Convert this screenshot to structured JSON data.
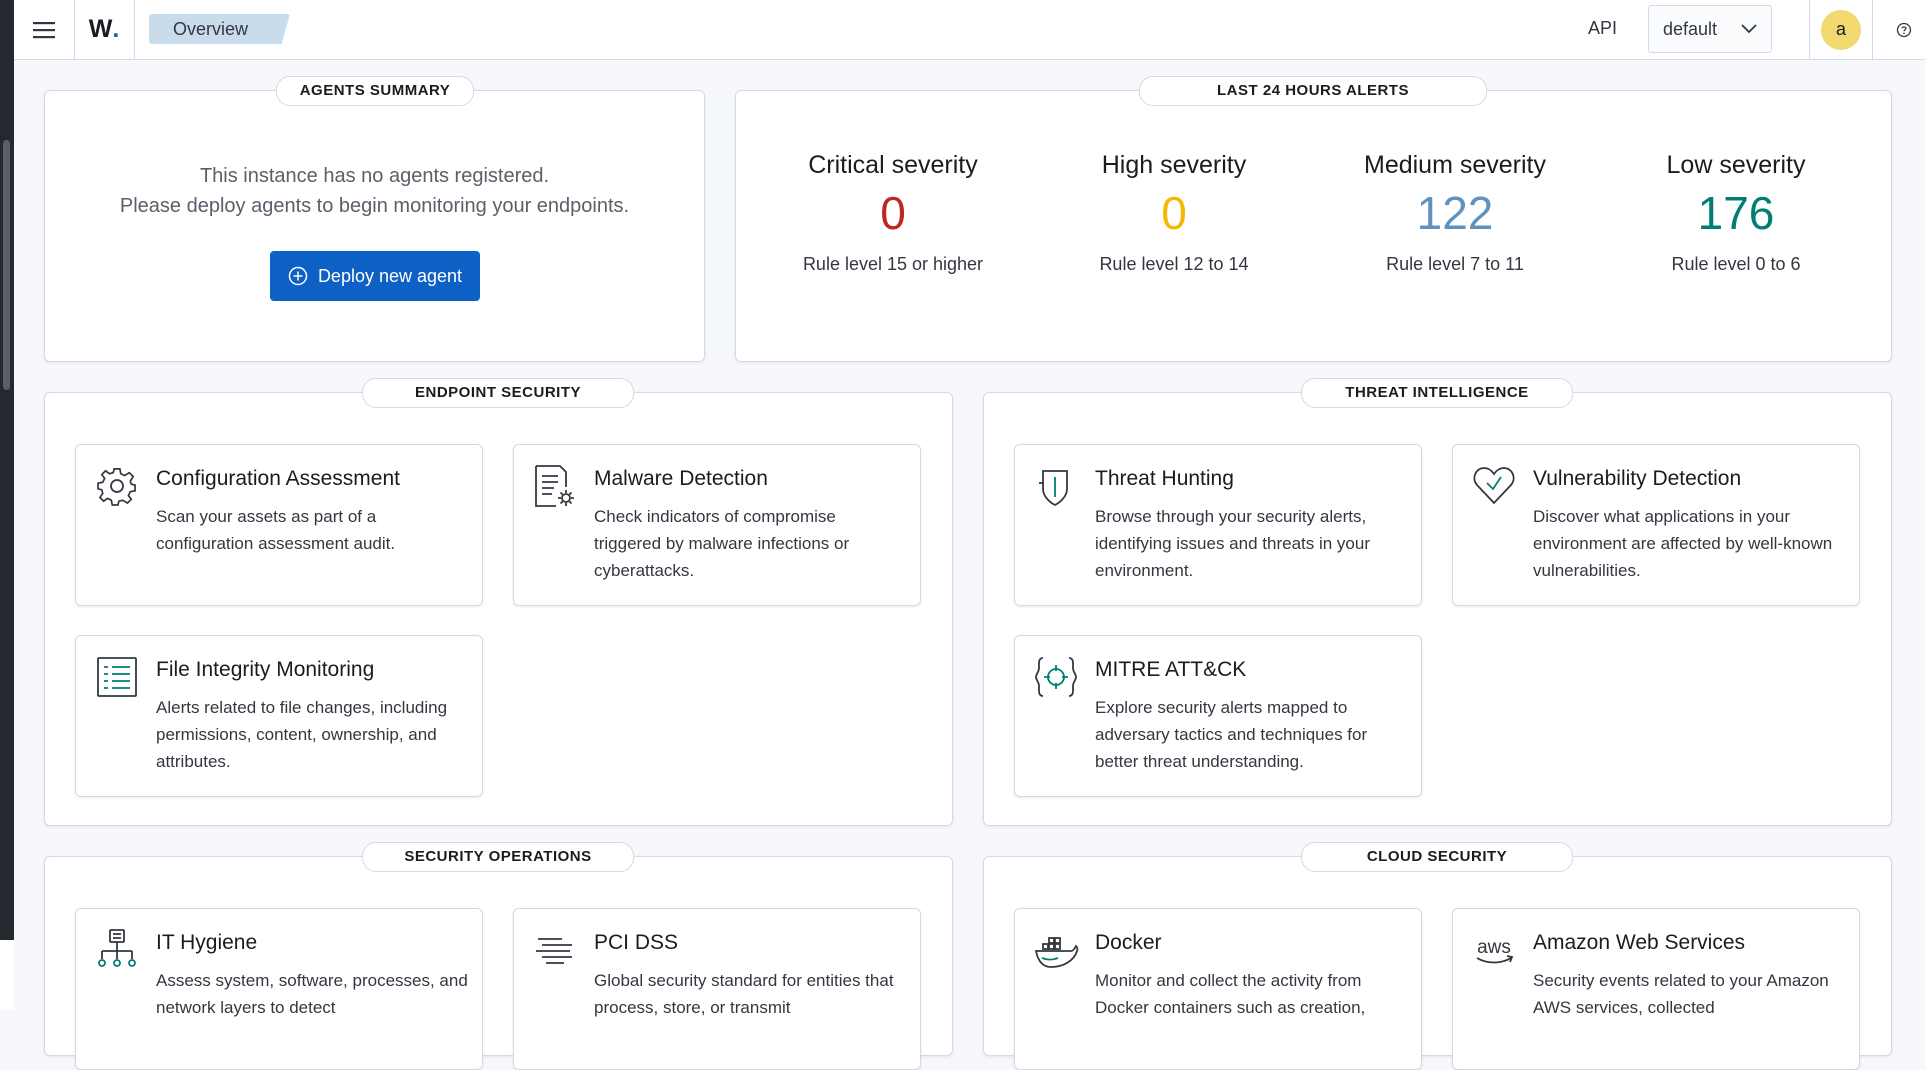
{
  "header": {
    "logo_text": "W",
    "logo_dot": ".",
    "breadcrumb": "Overview",
    "api_label": "API",
    "tenant_value": "default",
    "avatar_letter": "a"
  },
  "agents_summary": {
    "title": "AGENTS SUMMARY",
    "message_line1": "This instance has no agents registered.",
    "message_line2": "Please deploy agents to begin monitoring your endpoints.",
    "deploy_button": "Deploy new agent"
  },
  "alerts": {
    "title": "LAST 24 HOURS ALERTS",
    "items": [
      {
        "title": "Critical severity",
        "value": "0",
        "rule": "Rule level 15 or higher",
        "color": "#bd271e"
      },
      {
        "title": "High severity",
        "value": "0",
        "rule": "Rule level 12 to 14",
        "color": "#f5b800"
      },
      {
        "title": "Medium severity",
        "value": "122",
        "rule": "Rule level 7 to 11",
        "color": "#6092c0"
      },
      {
        "title": "Low severity",
        "value": "176",
        "rule": "Rule level 0 to 6",
        "color": "#017d73"
      }
    ]
  },
  "sections": {
    "endpoint": {
      "title": "ENDPOINT SECURITY",
      "cards": [
        {
          "icon": "gear-icon",
          "title": "Configuration Assessment",
          "desc": "Scan your assets as part of a configuration assessment audit."
        },
        {
          "icon": "document-gear-icon",
          "title": "Malware Detection",
          "desc": "Check indicators of compromise triggered by malware infections or cyberattacks."
        },
        {
          "icon": "list-document-icon",
          "title": "File Integrity Monitoring",
          "desc": "Alerts related to file changes, including permissions, content, ownership, and attributes."
        }
      ]
    },
    "threat": {
      "title": "THREAT INTELLIGENCE",
      "cards": [
        {
          "icon": "shield-icon",
          "title": "Threat Hunting",
          "desc": "Browse through your security alerts, identifying issues and threats in your environment."
        },
        {
          "icon": "heart-icon",
          "title": "Vulnerability Detection",
          "desc": "Discover what applications in your environment are affected by well-known vulnerabilities."
        },
        {
          "icon": "crosshair-icon",
          "title": "MITRE ATT&CK",
          "desc": "Explore security alerts mapped to adversary tactics and techniques for better threat understanding."
        }
      ]
    },
    "secops": {
      "title": "SECURITY OPERATIONS",
      "cards": [
        {
          "icon": "network-icon",
          "title": "IT Hygiene",
          "desc": "Assess system, software, processes, and network layers to detect"
        },
        {
          "icon": "lines-icon",
          "title": "PCI DSS",
          "desc": "Global security standard for entities that process, store, or transmit"
        }
      ]
    },
    "cloud": {
      "title": "CLOUD SECURITY",
      "cards": [
        {
          "icon": "docker-icon",
          "title": "Docker",
          "desc": "Monitor and collect the activity from Docker containers such as creation,"
        },
        {
          "icon": "aws-icon",
          "title": "Amazon Web Services",
          "desc": "Security events related to your Amazon AWS services, collected"
        }
      ]
    }
  }
}
